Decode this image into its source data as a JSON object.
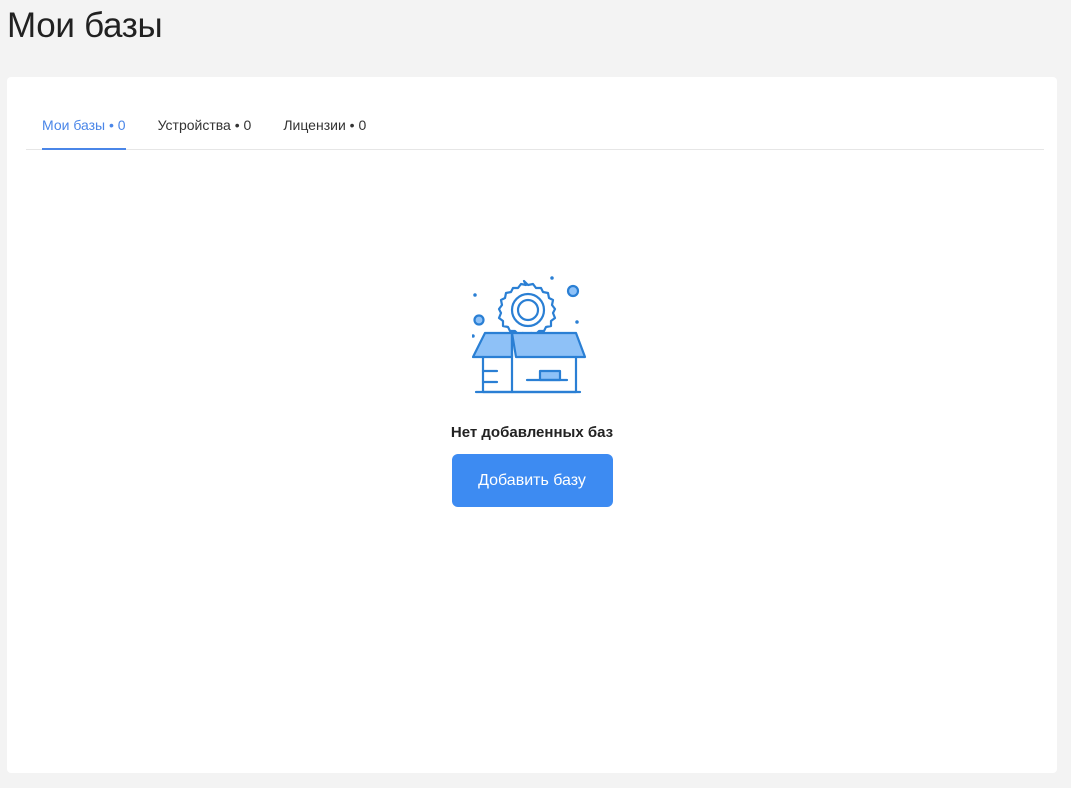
{
  "page": {
    "title": "Мои базы"
  },
  "tabs": [
    {
      "label": "Мои базы • 0",
      "active": true
    },
    {
      "label": "Устройства • 0",
      "active": false
    },
    {
      "label": "Лицензии • 0",
      "active": false
    }
  ],
  "empty_state": {
    "icon": "box-gear-icon",
    "message": "Нет добавленных баз",
    "button_label": "Добавить базу"
  },
  "colors": {
    "accent": "#3d8bf2",
    "tab_active": "#4a86e8",
    "illustration_stroke": "#2a7fd4",
    "illustration_fill": "#8ec1f7"
  }
}
